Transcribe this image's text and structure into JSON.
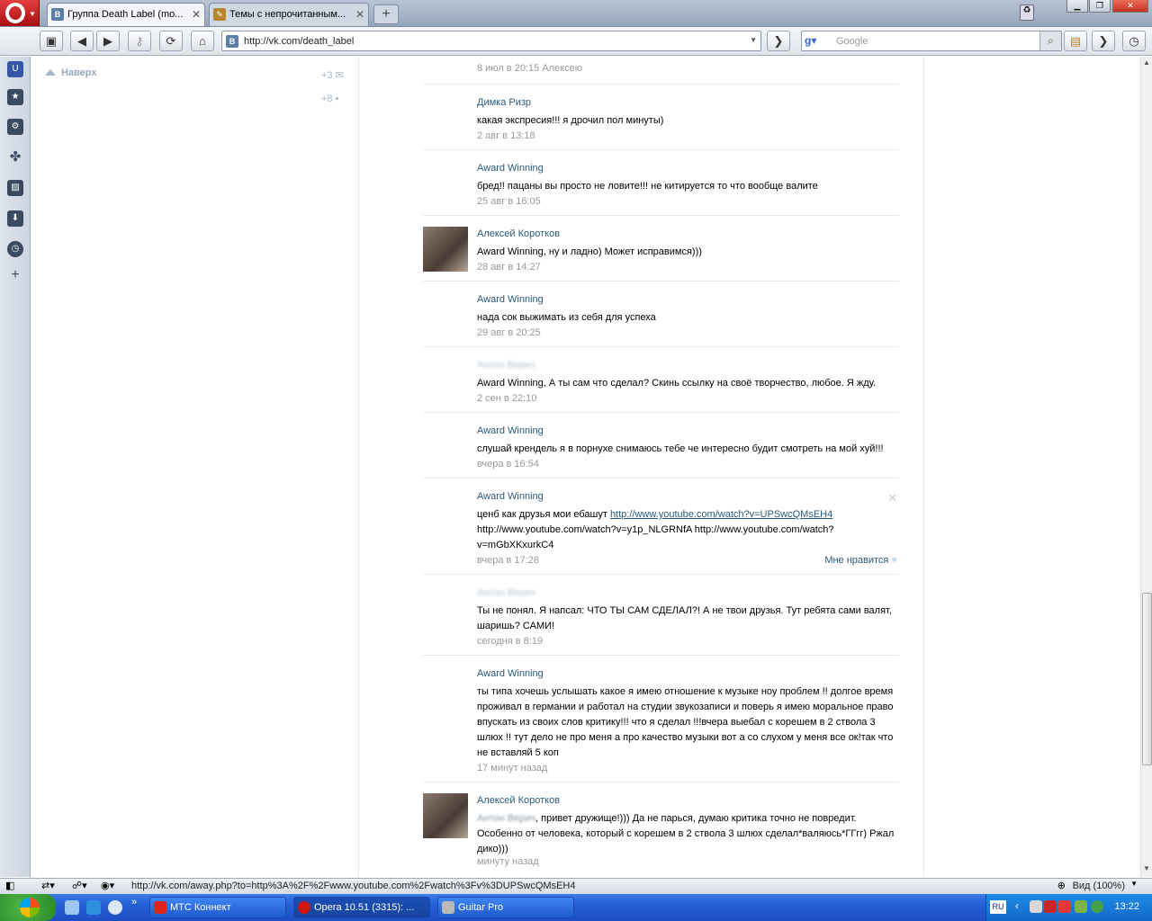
{
  "browser": {
    "tabs": [
      {
        "label": "Группа Death Label (mo...",
        "icon": "vk-icon",
        "active": true
      },
      {
        "label": "Темы с непрочитанным...",
        "icon": "forum-icon",
        "active": false
      }
    ],
    "address": "http://vk.com/death_label",
    "search_placeholder": "Google",
    "status_url": "http://vk.com/away.php?to=http%3A%2F%2Fwww.youtube.com%2Fwatch%3Fv%3DUPSwcQMsEH4",
    "zoom": "Вид (100%)"
  },
  "sidebar": {
    "up_label": "Наверх",
    "counter_messages": "+3",
    "counter_comments": "+8"
  },
  "comments": [
    {
      "author": "",
      "text": "",
      "date": "8 июл в 20:15 Алексею",
      "blurred": false
    },
    {
      "author": "Димка Ризр",
      "text": "какая экспресия!!! я дрочил пол минуты)",
      "date": "2 авг в 13:18",
      "blurred": false
    },
    {
      "author": "Award Winning",
      "text": "бред!! пацаны вы просто не ловите!!! не китируется то что вообще валите",
      "date": "25 авг в 16:05",
      "blurred": false
    },
    {
      "author": "Алексей Коротков",
      "text": "Award Winning, ну и ладно) Может исправимся)))",
      "date": "28 авг в 14:27",
      "blurred": false,
      "avatar": true
    },
    {
      "author": "Award Winning",
      "text": "нада сок выжимать из себя для успеха",
      "date": "29 авг в 20:25",
      "blurred": false
    },
    {
      "author": "Антон Верич",
      "text": "Award Winning, А ты сам что сделал? Скинь ссылку на своё творчество, любое. Я жду.",
      "date": "2 сен в 22:10",
      "blurred": true
    },
    {
      "author": "Award Winning",
      "text": "слушай крендель я в порнухе снимаюсь тебе че интересно будит смотреть на мой хуй!!!",
      "date": "вчера в 16:54",
      "blurred": false
    },
    {
      "author": "Award Winning",
      "text_prefix": "ценб как друзья мои ебашут ",
      "link1": "http://www.youtube.com/watch?v=UPSwcQMsEH4",
      "text_rest": "http://www.youtube.com/watch?v=y1p_NLGRNfA http://www.youtube.com/watch?v=mGbXKxurkC4",
      "date": "вчера в 17:28",
      "like": "Мне нравится"
    },
    {
      "author": "Антон Верич",
      "text": "Ты не понял. Я напсал: ЧТО ТЫ САМ СДЕЛАЛ?! А не твои друзья. Тут ребята сами валят, шаришь? САМИ!",
      "date": "сегодня в 8:19",
      "blurred": true
    },
    {
      "author": "Award Winning",
      "text": "ты типа хочешь услышать какое я имею отношение к музыке ноу проблем !! долгое время проживал в германии и работал на студии звукозаписи и поверь я имею моральное право впускать из своих слов критику!!! что я сделал !!!вчера выебал с корешем в 2 ствола 3 шлюх !! тут дело не про меня а про качество музыки вот а со слухом у меня все ок!так что не вставляй 5 коп",
      "date": "17 минут назад"
    },
    {
      "author": "Алексей Коротков",
      "blur_name": "Антон Верич",
      "text": ", привет дружище!))) Да не парься, думаю критика точно не повредит. Особенно от человека, который с корешем в 2 ствола 3 шлюх сделал*валяюсь*ГГгг) Ржал дико)))",
      "date": "минуту назад",
      "avatar": true
    }
  ],
  "taskbar": {
    "items": [
      "МТС Коннект",
      "Opera 10.51 (3315): ...",
      "Guitar Pro"
    ],
    "lang": "RU",
    "clock": "13:22"
  }
}
